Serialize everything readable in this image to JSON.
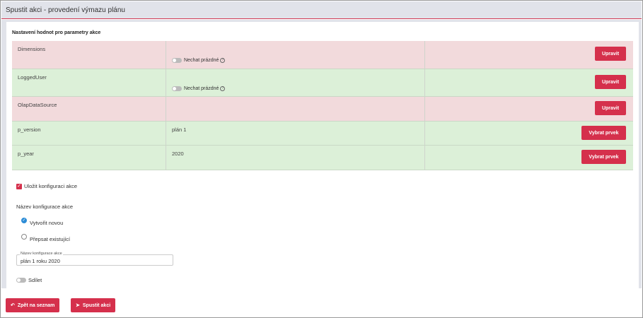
{
  "window": {
    "title": "Spustit akci - provedení výmazu plánu"
  },
  "section": {
    "title": "Nastavení hodnot pro parametry akce"
  },
  "params": [
    {
      "name": "Dimensions",
      "value": "",
      "keep_empty": "Nechat prázdné",
      "button": "Upravit",
      "status": "red"
    },
    {
      "name": "LoggedUser",
      "value": "",
      "keep_empty": "Nechat prázdné",
      "button": "Upravit",
      "status": "green"
    },
    {
      "name": "OlapDataSource",
      "value": "",
      "keep_empty": "",
      "button": "Upravit",
      "status": "red"
    },
    {
      "name": "p_version",
      "value": "plán 1",
      "keep_empty": "",
      "button": "Vybrat prvek",
      "status": "green"
    },
    {
      "name": "p_year",
      "value": "2020",
      "keep_empty": "",
      "button": "Vybrat prvek",
      "status": "green"
    }
  ],
  "save_config": {
    "label": "Uložit konfiguraci akce",
    "checked": true
  },
  "config_name": {
    "heading": "Název konfigurace akce",
    "create_new": "Vytvořit novou",
    "overwrite": "Přepsat existující",
    "field_label": "Název konfigurace akce",
    "field_value": "plán 1 roku 2020"
  },
  "share": {
    "label": "Sdílet"
  },
  "footer": {
    "back": "Zpět na seznam",
    "run": "Spustit akci"
  },
  "colors": {
    "accent": "#d5304c",
    "row_red": "#f2dadc",
    "row_green": "#dcf0d8",
    "radio_on": "#2c8cd6"
  }
}
